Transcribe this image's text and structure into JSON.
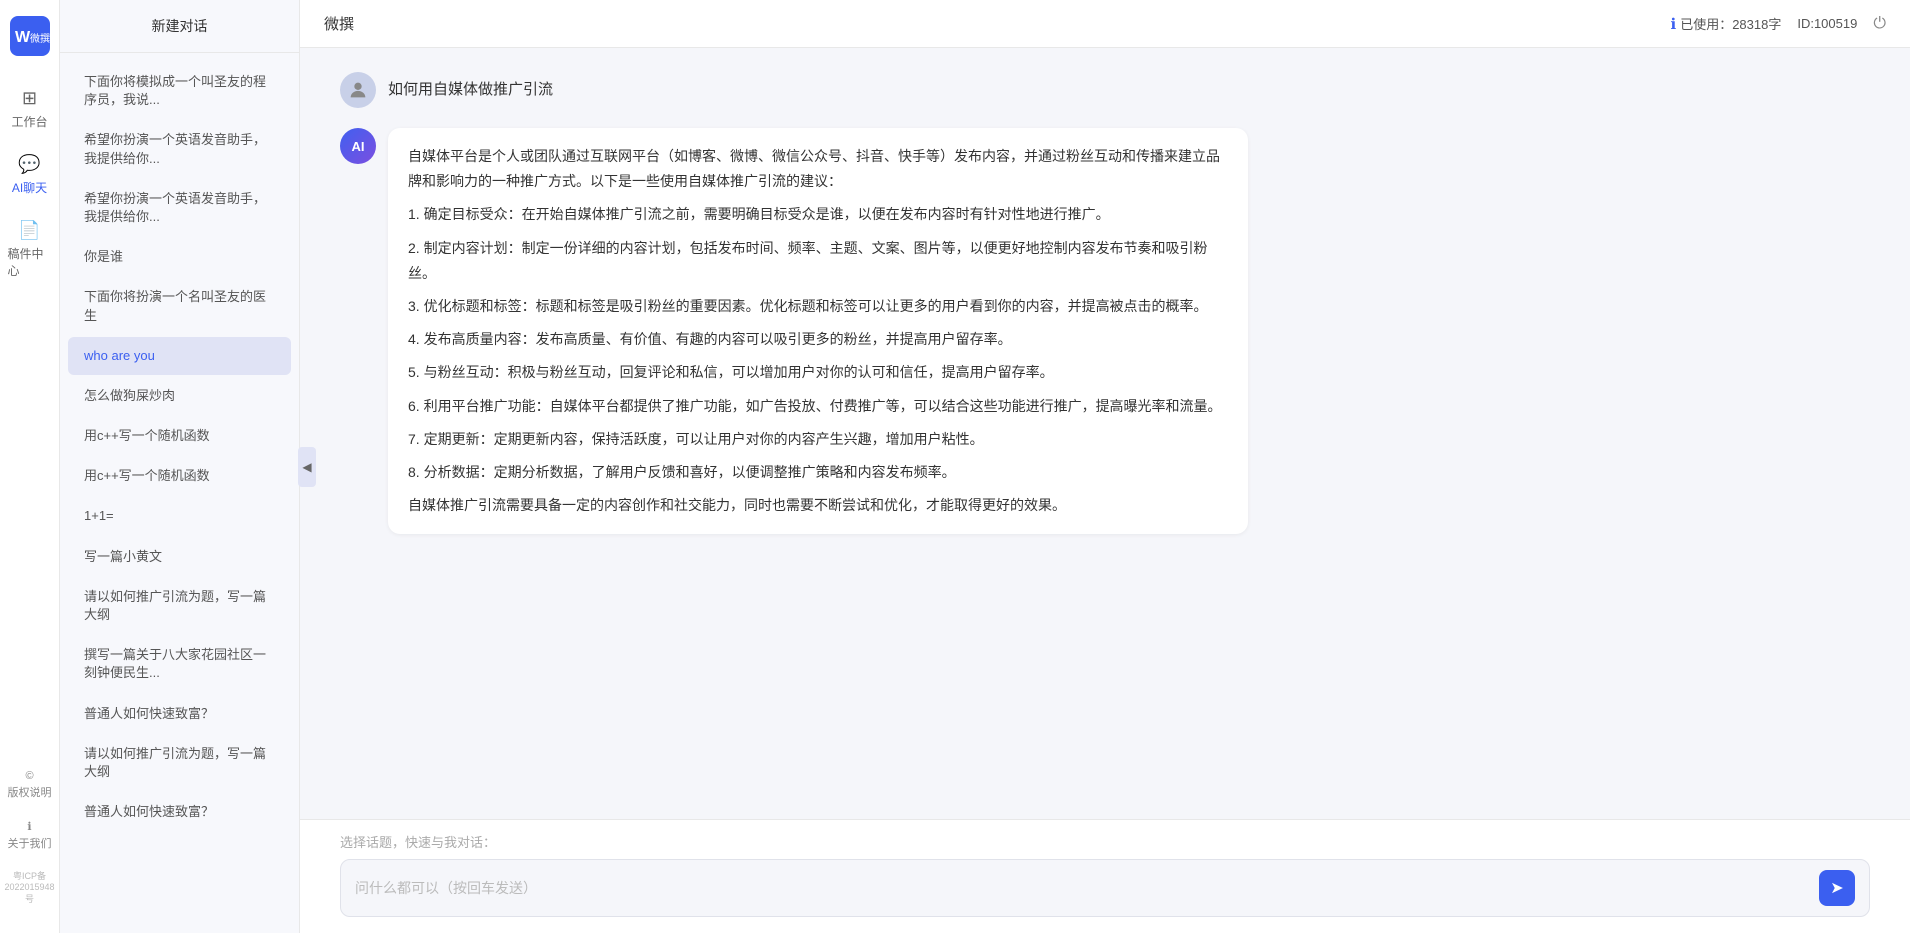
{
  "app": {
    "title": "微撰",
    "logo_text": "W 微撰"
  },
  "header": {
    "title": "微撰",
    "usage_label": "已使用：28318字",
    "user_id": "ID:100519",
    "usage_icon": "ℹ"
  },
  "nav": {
    "items": [
      {
        "id": "workspace",
        "label": "工作台",
        "icon": "⊞"
      },
      {
        "id": "ai-chat",
        "label": "AI聊天",
        "icon": "💬",
        "active": true
      },
      {
        "id": "components",
        "label": "稿件中心",
        "icon": "📄"
      }
    ],
    "bottom": [
      {
        "id": "copyright",
        "label": "版权说明",
        "icon": "©"
      },
      {
        "id": "about",
        "label": "关于我们",
        "icon": "ℹ"
      }
    ],
    "icp": "粤ICP备2022015948号"
  },
  "sidebar": {
    "new_chat": "新建对话",
    "history": [
      {
        "id": 1,
        "text": "下面你将模拟成一个叫圣友的程序员，我说..."
      },
      {
        "id": 2,
        "text": "希望你扮演一个英语发音助手，我提供给你..."
      },
      {
        "id": 3,
        "text": "希望你扮演一个英语发音助手，我提供给你..."
      },
      {
        "id": 4,
        "text": "你是谁"
      },
      {
        "id": 5,
        "text": "下面你将扮演一个名叫圣友的医生"
      },
      {
        "id": 6,
        "text": "who are you",
        "active": true
      },
      {
        "id": 7,
        "text": "怎么做狗屎炒肉"
      },
      {
        "id": 8,
        "text": "用c++写一个随机函数"
      },
      {
        "id": 9,
        "text": "用c++写一个随机函数"
      },
      {
        "id": 10,
        "text": "1+1="
      },
      {
        "id": 11,
        "text": "写一篇小黄文"
      },
      {
        "id": 12,
        "text": "请以如何推广引流为题，写一篇大纲"
      },
      {
        "id": 13,
        "text": "撰写一篇关于八大家花园社区一刻钟便民生..."
      },
      {
        "id": 14,
        "text": "普通人如何快速致富？"
      },
      {
        "id": 15,
        "text": "请以如何推广引流为题，写一篇大纲"
      },
      {
        "id": 16,
        "text": "普通人如何快速致富？"
      }
    ]
  },
  "chat": {
    "user_message": "如何用自媒体做推广引流",
    "ai_response": {
      "paragraphs": [
        "自媒体平台是个人或团队通过互联网平台（如博客、微博、微信公众号、抖音、快手等）发布内容，并通过粉丝互动和传播来建立品牌和影响力的一种推广方式。以下是一些使用自媒体推广引流的建议：",
        "1. 确定目标受众：在开始自媒体推广引流之前，需要明确目标受众是谁，以便在发布内容时有针对性地进行推广。",
        "2. 制定内容计划：制定一份详细的内容计划，包括发布时间、频率、主题、文案、图片等，以便更好地控制内容发布节奏和吸引粉丝。",
        "3. 优化标题和标签：标题和标签是吸引粉丝的重要因素。优化标题和标签可以让更多的用户看到你的内容，并提高被点击的概率。",
        "4. 发布高质量内容：发布高质量、有价值、有趣的内容可以吸引更多的粉丝，并提高用户留存率。",
        "5. 与粉丝互动：积极与粉丝互动，回复评论和私信，可以增加用户对你的认可和信任，提高用户留存率。",
        "6. 利用平台推广功能：自媒体平台都提供了推广功能，如广告投放、付费推广等，可以结合这些功能进行推广，提高曝光率和流量。",
        "7. 定期更新：定期更新内容，保持活跃度，可以让用户对你的内容产生兴趣，增加用户粘性。",
        "8. 分析数据：定期分析数据，了解用户反馈和喜好，以便调整推广策略和内容发布频率。",
        "自媒体推广引流需要具备一定的内容创作和社交能力，同时也需要不断尝试和优化，才能取得更好的效果。"
      ]
    }
  },
  "input": {
    "quick_topics_label": "选择话题，快速与我对话：",
    "placeholder": "问什么都可以（按回车发送）",
    "send_icon": "➤"
  }
}
